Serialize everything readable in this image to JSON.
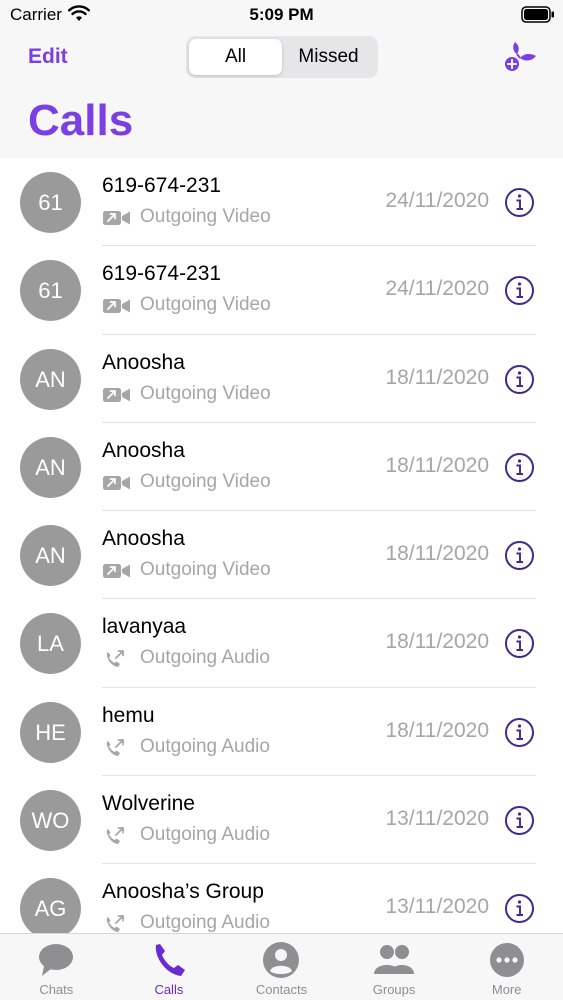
{
  "status_bar": {
    "carrier": "Carrier",
    "time": "5:09 PM"
  },
  "header": {
    "edit_label": "Edit",
    "segments": [
      {
        "label": "All",
        "selected": true
      },
      {
        "label": "Missed",
        "selected": false
      }
    ],
    "title": "Calls",
    "new_call_icon": "add-contact-leaves-icon"
  },
  "calls": [
    {
      "initials": "61",
      "name": "619-674-231",
      "type_icon": "outgoing-video-icon",
      "type": "Outgoing Video",
      "date": "24/11/2020"
    },
    {
      "initials": "61",
      "name": "619-674-231",
      "type_icon": "outgoing-video-icon",
      "type": "Outgoing Video",
      "date": "24/11/2020"
    },
    {
      "initials": "AN",
      "name": "Anoosha",
      "type_icon": "outgoing-video-icon",
      "type": "Outgoing Video",
      "date": "18/11/2020"
    },
    {
      "initials": "AN",
      "name": "Anoosha",
      "type_icon": "outgoing-video-icon",
      "type": "Outgoing Video",
      "date": "18/11/2020"
    },
    {
      "initials": "AN",
      "name": "Anoosha",
      "type_icon": "outgoing-video-icon",
      "type": "Outgoing Video",
      "date": "18/11/2020"
    },
    {
      "initials": "LA",
      "name": "lavanyaa",
      "type_icon": "outgoing-audio-icon",
      "type": "Outgoing Audio",
      "date": "18/11/2020"
    },
    {
      "initials": "HE",
      "name": "hemu",
      "type_icon": "outgoing-audio-icon",
      "type": "Outgoing Audio",
      "date": "18/11/2020"
    },
    {
      "initials": "WO",
      "name": "Wolverine",
      "type_icon": "outgoing-audio-icon",
      "type": "Outgoing Audio",
      "date": "13/11/2020"
    },
    {
      "initials": "AG",
      "name": "Anoosha’s Group",
      "type_icon": "outgoing-audio-icon",
      "type": "Outgoing Audio",
      "date": "13/11/2020"
    }
  ],
  "tab_bar": {
    "tabs": [
      {
        "label": "Chats",
        "icon": "chat-bubble-icon",
        "active": false
      },
      {
        "label": "Calls",
        "icon": "phone-icon",
        "active": true
      },
      {
        "label": "Contacts",
        "icon": "person-circle-icon",
        "active": false
      },
      {
        "label": "Groups",
        "icon": "people-icon",
        "active": false
      },
      {
        "label": "More",
        "icon": "more-dots-icon",
        "active": false
      }
    ]
  },
  "colors": {
    "accent": "#7b3fe4",
    "tab_active": "#6a2bd1",
    "avatar_bg": "#9a9a9a",
    "secondary_text": "#a6a6a6",
    "info_icon": "#3f2a8a"
  }
}
